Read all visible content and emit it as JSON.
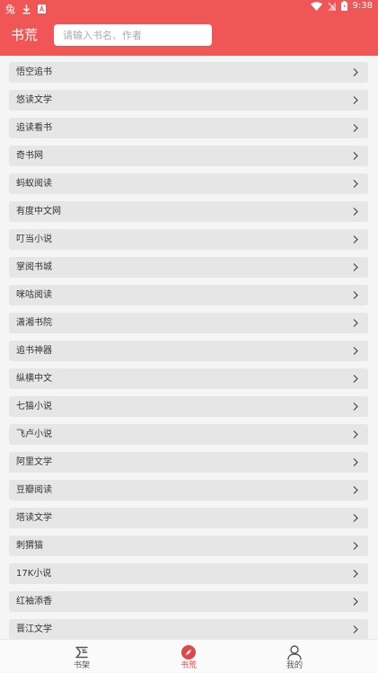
{
  "status_bar": {
    "app_glyph": "兔",
    "time": "9:38"
  },
  "app_bar": {
    "title": "书荒",
    "search_placeholder": "请输入书名、作者"
  },
  "colors": {
    "accent": "#f05656",
    "active_tab": "#e0474a",
    "list_item_bg": "#e6e6e6"
  },
  "sources": [
    {
      "label": "悟空追书"
    },
    {
      "label": "悠读文学"
    },
    {
      "label": "追读看书"
    },
    {
      "label": "奇书网"
    },
    {
      "label": "蚂蚁阅读"
    },
    {
      "label": "有度中文网"
    },
    {
      "label": "叮当小说"
    },
    {
      "label": "掌阅书城"
    },
    {
      "label": "咪咕阅读"
    },
    {
      "label": "潇湘书院"
    },
    {
      "label": "追书神器"
    },
    {
      "label": "纵横中文"
    },
    {
      "label": "七猫小说"
    },
    {
      "label": "飞卢小说"
    },
    {
      "label": "阿里文学"
    },
    {
      "label": "豆瓣阅读"
    },
    {
      "label": "塔读文学"
    },
    {
      "label": "刺猬猫"
    },
    {
      "label": "17K小说"
    },
    {
      "label": "红袖添香"
    },
    {
      "label": "晋江文学"
    }
  ],
  "tabs": [
    {
      "label": "书架",
      "icon": "bookshelf-icon",
      "active": false
    },
    {
      "label": "书荒",
      "icon": "compass-icon",
      "active": true
    },
    {
      "label": "我的",
      "icon": "person-icon",
      "active": false
    }
  ]
}
